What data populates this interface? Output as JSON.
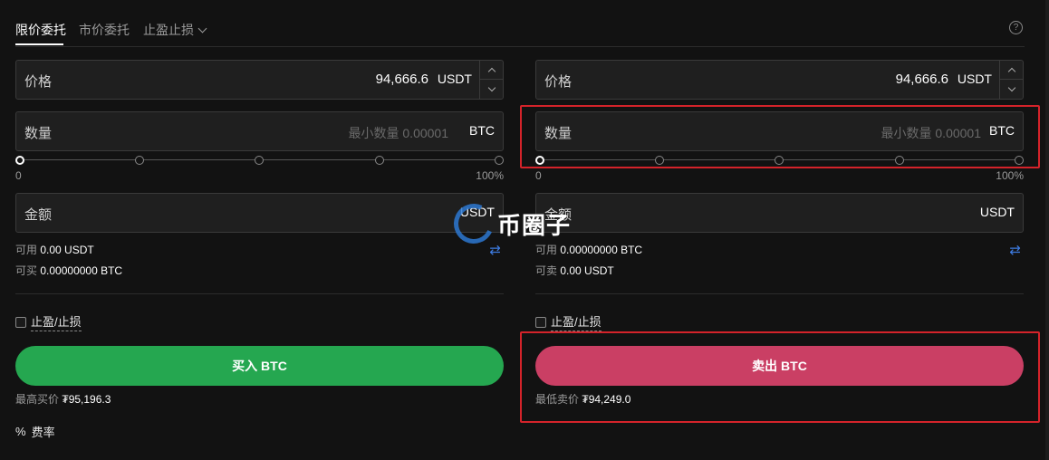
{
  "tabs": {
    "items": [
      {
        "label": "限价委托"
      },
      {
        "label": "市价委托"
      },
      {
        "label": "止盈止损"
      }
    ],
    "help_icon": "?"
  },
  "buy": {
    "price": {
      "label": "价格",
      "value": "94,666.6",
      "unit": "USDT"
    },
    "quantity": {
      "label": "数量",
      "placeholder": "最小数量 0.00001",
      "unit": "BTC"
    },
    "slider": {
      "min_label": "0",
      "max_label": "100%",
      "value_percent": 0
    },
    "amount": {
      "label": "金额",
      "unit": "USDT"
    },
    "available": {
      "label": "可用",
      "value": "0.00 USDT"
    },
    "can_buy": {
      "label": "可买",
      "value": "0.00000000 BTC"
    },
    "tpsl_label": "止盈/止损",
    "button_label": "买入 BTC",
    "best_price": {
      "label": "最高买价",
      "value": "₮95,196.3"
    }
  },
  "sell": {
    "price": {
      "label": "价格",
      "value": "94,666.6",
      "unit": "USDT"
    },
    "quantity": {
      "label": "数量",
      "placeholder": "最小数量 0.00001",
      "unit": "BTC"
    },
    "slider": {
      "min_label": "0",
      "max_label": "100%",
      "value_percent": 0
    },
    "amount": {
      "label": "金额",
      "unit": "USDT"
    },
    "available": {
      "label": "可用",
      "value": "0.00000000 BTC"
    },
    "can_sell": {
      "label": "可卖",
      "value": "0.00 USDT"
    },
    "tpsl_label": "止盈/止损",
    "button_label": "卖出 BTC",
    "best_price": {
      "label": "最低卖价",
      "value": "₮94,249.0"
    }
  },
  "fee": {
    "icon": "%",
    "label": "费率"
  },
  "watermark": {
    "text": "币圈子"
  },
  "colors": {
    "buy": "#25a750",
    "sell": "#ca3f64",
    "highlight": "#d4232a",
    "accent": "#3d7be0"
  },
  "icons": {
    "swap": "swap-icon",
    "stepper": "stepper-arrows"
  }
}
